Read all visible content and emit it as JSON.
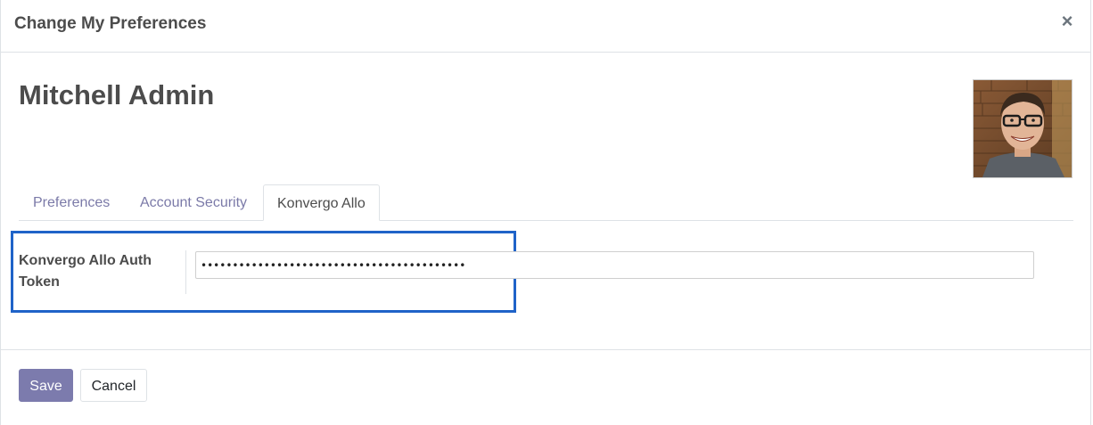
{
  "dialog": {
    "title": "Change My Preferences",
    "close_glyph": "×",
    "close_icon": "close-icon"
  },
  "record": {
    "name": "Mitchell Admin",
    "avatar": "user-photo"
  },
  "tabs": [
    {
      "label": "Preferences",
      "active": false
    },
    {
      "label": "Account Security",
      "active": false
    },
    {
      "label": "Konvergo Allo",
      "active": true
    }
  ],
  "field": {
    "label": "Konvergo Allo Auth Token",
    "value": "••••••••••••••••••••••••••••••••••••••••••",
    "highlight_color": "#1f63c8"
  },
  "footer": {
    "save_label": "Save",
    "cancel_label": "Cancel",
    "primary_color": "#7c7bad"
  }
}
